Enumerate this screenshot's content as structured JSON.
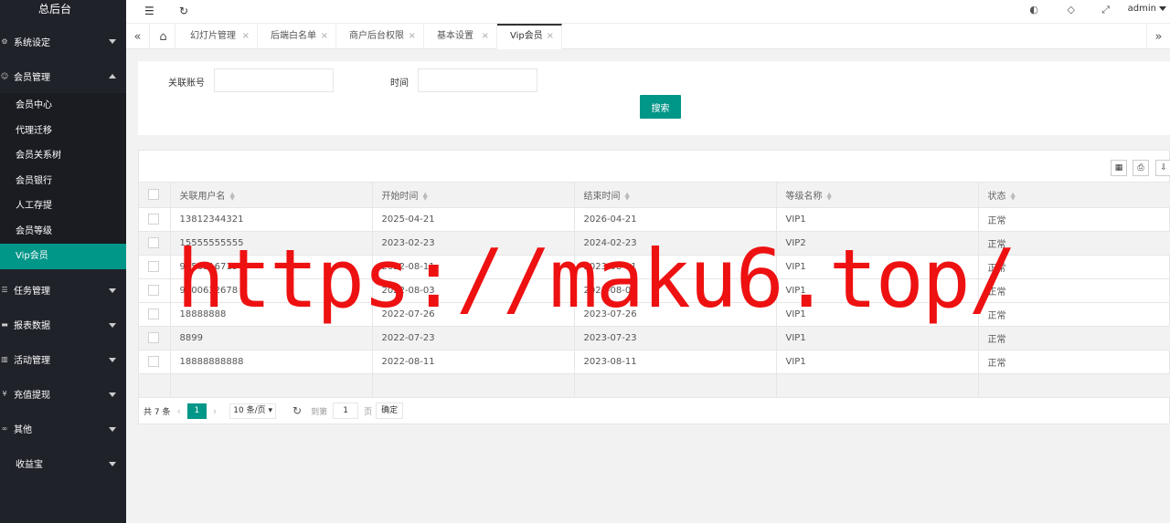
{
  "app": {
    "title": "总后台"
  },
  "sidebar": {
    "groups": [
      {
        "label": "系统设定",
        "icon": "gear-icon",
        "expanded": false
      },
      {
        "label": "会员管理",
        "icon": "user-icon",
        "expanded": true,
        "items": [
          "会员中心",
          "代理迁移",
          "会员关系树",
          "会员银行",
          "人工存提",
          "会员等级",
          "Vip会员"
        ],
        "active_item": "Vip会员"
      },
      {
        "label": "任务管理",
        "icon": "tasks-icon",
        "expanded": false
      },
      {
        "label": "报表数据",
        "icon": "report-icon",
        "expanded": false
      },
      {
        "label": "活动管理",
        "icon": "activity-icon",
        "expanded": false
      },
      {
        "label": "充值提现",
        "icon": "yen-icon",
        "expanded": false
      },
      {
        "label": "其他",
        "icon": "link-icon",
        "expanded": false
      },
      {
        "label": "收益宝",
        "icon": "",
        "expanded": false
      }
    ]
  },
  "header": {
    "user": "admin"
  },
  "tabs": [
    {
      "label": "幻灯片管理"
    },
    {
      "label": "后端白名单"
    },
    {
      "label": "商户后台权限"
    },
    {
      "label": "基本设置"
    },
    {
      "label": "Vip会员",
      "active": true
    }
  ],
  "search": {
    "account_label": "关联账号",
    "account_value": "",
    "time_label": "时间",
    "time_value": "",
    "button": "搜索"
  },
  "table": {
    "columns": [
      "关联用户名",
      "开始时间",
      "结束时间",
      "等级名称",
      "状态"
    ],
    "rows": [
      [
        "13812344321",
        "2025-04-21",
        "2026-04-21",
        "VIP1",
        "正常"
      ],
      [
        "15555555555",
        "2023-02-23",
        "2024-02-23",
        "VIP2",
        "正常"
      ],
      [
        "9656516719",
        "2022-08-11",
        "2023-08-11",
        "VIP1",
        "正常"
      ],
      [
        "9800632678",
        "2022-08-03",
        "2023-08-03",
        "VIP1",
        "正常"
      ],
      [
        "18888888",
        "2022-07-26",
        "2023-07-26",
        "VIP1",
        "正常"
      ],
      [
        "8899",
        "2022-07-23",
        "2023-07-23",
        "VIP1",
        "正常"
      ],
      [
        "18888888888",
        "2022-08-11",
        "2023-08-11",
        "VIP1",
        "正常"
      ]
    ]
  },
  "pager": {
    "total": "共 7 条",
    "current": "1",
    "per_page": "10 条/页",
    "goto_label": "到第",
    "goto_value": "1",
    "page_label": "页",
    "confirm": "确定"
  },
  "watermark": "https://maku6.top/"
}
